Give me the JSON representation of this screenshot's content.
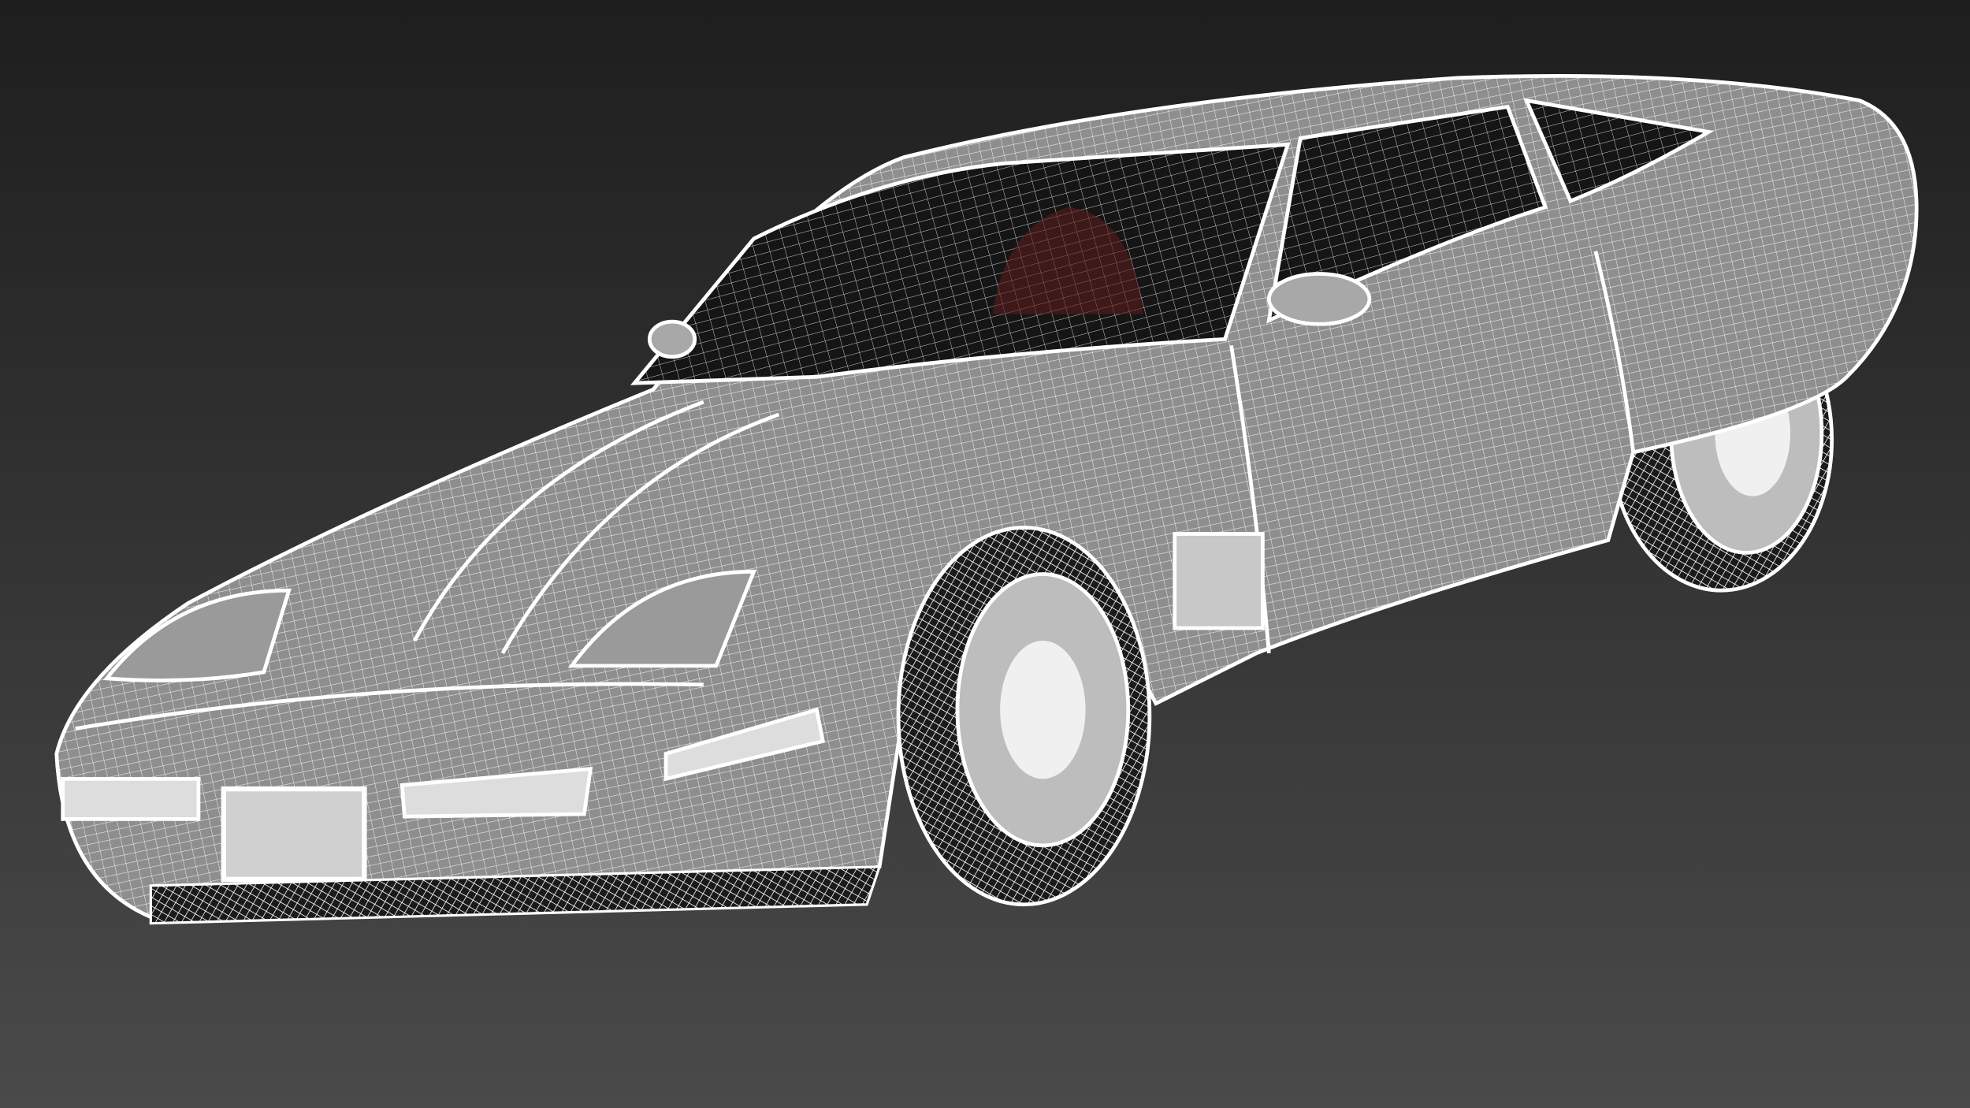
{
  "colors": {
    "background_top": "#1e1e1e",
    "background_bottom": "#4a4a4a",
    "body_fill": "#8c8c8c",
    "wire": "#ffffff",
    "glass": "#141414",
    "interior": "#5a1c1c"
  }
}
